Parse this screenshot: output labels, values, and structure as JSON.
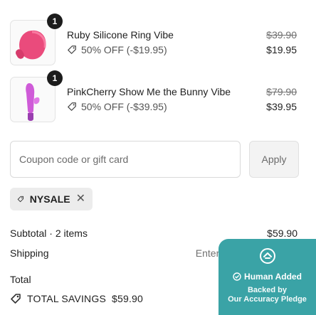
{
  "cart": {
    "items": [
      {
        "name": "Ruby Silicone Ring Vibe",
        "quantity": "1",
        "discount": "50% OFF (-$19.95)",
        "original_price": "$39.90",
        "final_price": "$19.95",
        "image_color": "#e8457a"
      },
      {
        "name": "PinkCherry Show Me the Bunny Vibe",
        "quantity": "1",
        "discount": "50% OFF (-$39.95)",
        "original_price": "$79.90",
        "final_price": "$39.95",
        "image_color": "#c85ad6"
      }
    ]
  },
  "coupon": {
    "placeholder": "Coupon code or gift card",
    "apply_label": "Apply",
    "applied_code": "NYSALE"
  },
  "summary": {
    "subtotal_label": "Subtotal · 2 items",
    "subtotal_value": "$59.90",
    "shipping_label": "Shipping",
    "shipping_value": "Enter shipping address",
    "total_label": "Total",
    "savings_label": "TOTAL SAVINGS",
    "savings_value": "$59.90"
  },
  "badge": {
    "title": "Human Added",
    "line1": "Backed by",
    "line2": "Our Accuracy Pledge",
    "color": "#3aa3a6"
  },
  "icons": {
    "discount_tag": "tag-icon",
    "remove": "close-icon",
    "badge": "pledge-icon"
  }
}
